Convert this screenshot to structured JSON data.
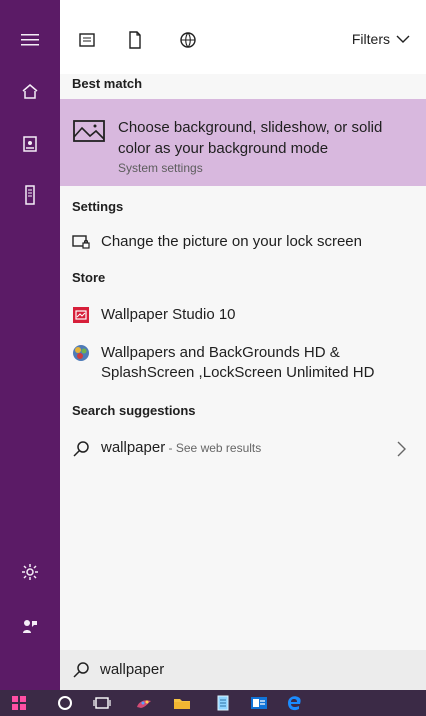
{
  "left_rail": {
    "icons": [
      {
        "name": "hamburger-menu-icon"
      },
      {
        "name": "home-icon"
      },
      {
        "name": "notebook-icon"
      },
      {
        "name": "device-icon"
      },
      {
        "name": "settings-gear-icon"
      },
      {
        "name": "feedback-icon"
      }
    ]
  },
  "topbar": {
    "filters_label": "Filters"
  },
  "sections": {
    "best_match_title": "Best match",
    "settings_title": "Settings",
    "store_title": "Store",
    "search_suggestions_title": "Search suggestions"
  },
  "best_match": {
    "title": "Choose background, slideshow, or solid color as your background mode",
    "subtitle": "System settings"
  },
  "settings_result": {
    "label": "Change the picture on your lock screen"
  },
  "store_results": [
    {
      "label": "Wallpaper Studio 10"
    },
    {
      "label": "Wallpapers and BackGrounds HD & SplashScreen ,LockScreen Unlimited HD"
    }
  ],
  "suggestion": {
    "query": "wallpaper",
    "suffix": " - See web results"
  },
  "searchbox": {
    "value": "wallpaper"
  },
  "colors": {
    "accent": "#5b1b66",
    "best_match_bg": "#d8b8de",
    "taskbar_bg": "#3b2a46"
  }
}
